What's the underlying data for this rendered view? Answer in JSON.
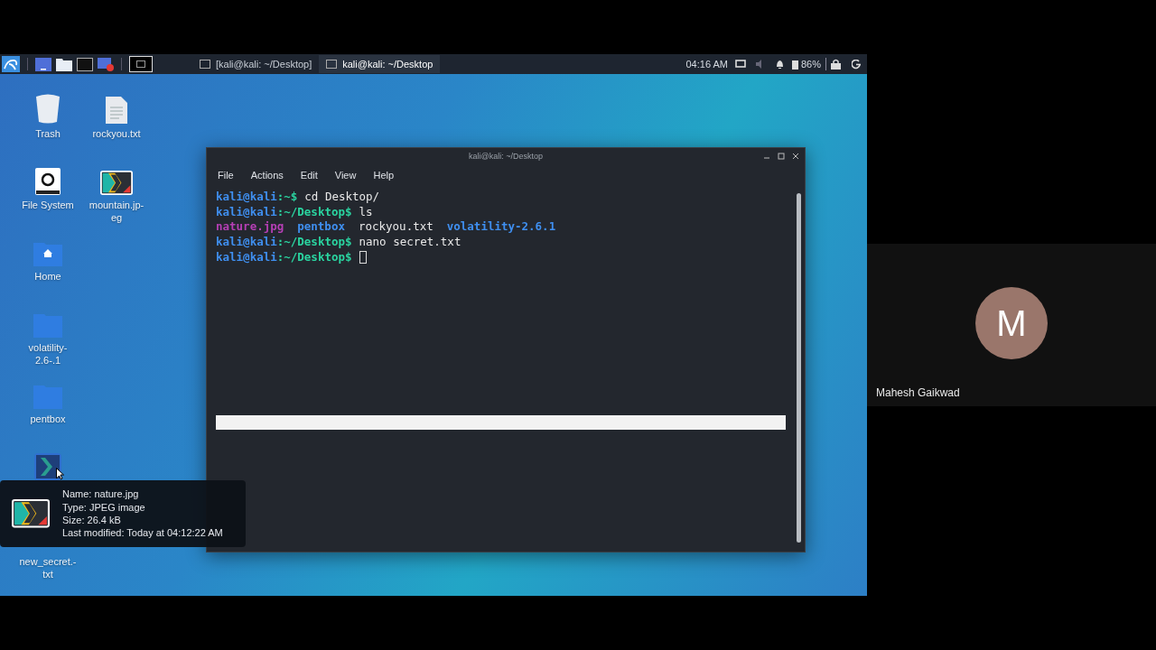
{
  "taskbar": {
    "tasks": [
      {
        "label": "[kali@kali: ~/Desktop]",
        "selected": false
      },
      {
        "label": "kali@kali: ~/Desktop",
        "selected": true
      }
    ],
    "clock": "04:16 AM",
    "battery": "86%"
  },
  "desktop_icons": [
    {
      "label": "Trash",
      "kind": "trash",
      "selected": false
    },
    {
      "label": "File System",
      "kind": "drive",
      "selected": false
    },
    {
      "label": "Home",
      "kind": "home",
      "selected": false
    },
    {
      "label": "volatility-2.6-.1",
      "kind": "folder",
      "selected": false
    },
    {
      "label": "pentbox",
      "kind": "folder",
      "selected": false
    },
    {
      "kind": "image",
      "selected": true
    },
    {
      "label": "new_secret.-txt",
      "kind": "covered",
      "selected": false
    },
    {
      "label": "rockyou.txt",
      "kind": "text",
      "selected": false
    },
    {
      "label": "mountain.jp-eg",
      "kind": "image",
      "selected": false
    }
  ],
  "terminal": {
    "title": "kali@kali: ~/Desktop",
    "menu": [
      "File",
      "Actions",
      "Edit",
      "View",
      "Help"
    ],
    "lines": [
      {
        "kind": "prompt",
        "user": "kali@kali",
        "path": ":~$",
        "command": "cd Desktop/",
        "cursor": false
      },
      {
        "kind": "prompt",
        "user": "kali@kali",
        "path": ":~/Desktop$",
        "command": "ls",
        "cursor": false
      },
      {
        "kind": "listing",
        "files": [
          {
            "name": "nature.jpg",
            "kind": "image"
          },
          {
            "name": "pentbox",
            "kind": "dir"
          },
          {
            "name": "rockyou.txt",
            "kind": "file"
          },
          {
            "name": "volatility-2.6.1",
            "kind": "dir"
          }
        ]
      },
      {
        "kind": "prompt",
        "user": "kali@kali",
        "path": ":~/Desktop$",
        "command": "nano secret.txt",
        "cursor": false
      },
      {
        "kind": "prompt",
        "user": "kali@kali",
        "path": ":~/Desktop$",
        "cursor": true
      }
    ]
  },
  "tooltip": {
    "lines": [
      "Name: nature.jpg",
      "Type: JPEG image",
      "Size: 26.4 kB",
      "Last modified: Today at 04:12:22 AM"
    ]
  },
  "participant": {
    "initial": "M",
    "name": "Mahesh Gaikwad"
  }
}
